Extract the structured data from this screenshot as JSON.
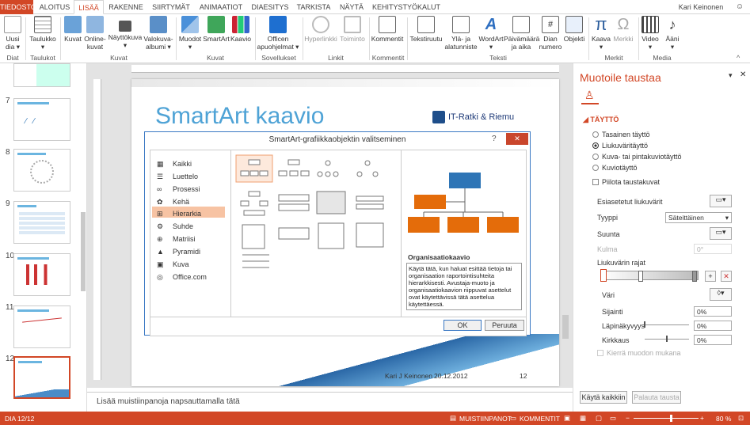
{
  "tabs": [
    "TIEDOSTO",
    "ALOITUS",
    "LISÄÄ",
    "RAKENNE",
    "SIIRTYMÄT",
    "ANIMAATIOT",
    "DIAESITYS",
    "TARKISTA",
    "NÄYTÄ",
    "KEHITYSTYÖKALUT"
  ],
  "user": "Kari Keinonen",
  "ribbon": {
    "buttons": [
      {
        "l1": "Uusi",
        "l2": "dia ▾"
      },
      {
        "l1": "Taulukko",
        "l2": "▾"
      },
      {
        "l1": "Kuvat",
        "l2": ""
      },
      {
        "l1": "Online-",
        "l2": "kuvat"
      },
      {
        "l1": "Näyttökuva",
        "l2": "▾"
      },
      {
        "l1": "Valokuva-",
        "l2": "albumi ▾"
      },
      {
        "l1": "Muodot",
        "l2": "▾"
      },
      {
        "l1": "SmartArt",
        "l2": ""
      },
      {
        "l1": "Kaavio",
        "l2": ""
      },
      {
        "l1": "Officen",
        "l2": "apuohjelmat ▾"
      },
      {
        "l1": "Hyperlinkki",
        "l2": ""
      },
      {
        "l1": "Toiminto",
        "l2": ""
      },
      {
        "l1": "Kommentit",
        "l2": ""
      },
      {
        "l1": "Tekstiruutu",
        "l2": ""
      },
      {
        "l1": "Ylä- ja",
        "l2": "alatunniste"
      },
      {
        "l1": "WordArt",
        "l2": "▾"
      },
      {
        "l1": "Päivämäärä",
        "l2": "ja aika"
      },
      {
        "l1": "Dian",
        "l2": "numero"
      },
      {
        "l1": "Objekti",
        "l2": ""
      },
      {
        "l1": "Kaava",
        "l2": "▾"
      },
      {
        "l1": "Merkki",
        "l2": ""
      },
      {
        "l1": "Video",
        "l2": "▾"
      },
      {
        "l1": "Ääni",
        "l2": "▾"
      }
    ],
    "groups": [
      "Diat",
      "Taulukot",
      "Kuvat",
      "Kuvat",
      "Sovellukset",
      "Linkit",
      "Kommentit",
      "Teksti",
      "Merkit",
      "Media"
    ]
  },
  "thumbs": [
    "7",
    "8",
    "9",
    "10",
    "11",
    "12"
  ],
  "slide": {
    "title": "SmartArt kaavio",
    "brand": "IT-Ratki & Riemu",
    "author": "Kari J Keinonen",
    "date": "20.12.2012",
    "num": "12"
  },
  "dialog": {
    "title": "SmartArt-grafiikkaobjektin valitseminen",
    "help": "?",
    "close": "✕",
    "categories": [
      "Kaikki",
      "Luettelo",
      "Prosessi",
      "Kehä",
      "Hierarkia",
      "Suhde",
      "Matriisi",
      "Pyramidi",
      "Kuva",
      "Office.com"
    ],
    "selected_category": "Hierarkia",
    "preview_title": "Organisaatiokaavio",
    "preview_desc": "Käytä tätä, kun haluat esittää tietoja tai organisaation raportointisuhteita hierarkkisesti. Avustaja-muoto ja organisaatiokaavion riippuvat asettelut ovat käytettävissä tätä asettelua käytettäessä.",
    "ok": "OK",
    "cancel": "Peruuta"
  },
  "notes": "Lisää muistiinpanoja napsauttamalla tätä",
  "pane": {
    "title": "Muotoile taustaa",
    "section": "TÄYTTÖ",
    "fill_options": [
      "Tasainen täyttö",
      "Liukuväritäyttö",
      "Kuva- tai pintakuviotäyttö",
      "Kuviotäyttö"
    ],
    "selected_fill": "Liukuväritäyttö",
    "hide_bg": "Piilota taustakuvat",
    "preset": "Esiasetetut liukuvärit",
    "type_label": "Tyyppi",
    "type_value": "Säteittäinen",
    "direction": "Suunta",
    "angle": "Kulma",
    "angle_value": "0°",
    "stops": "Liukuvärin rajat",
    "color": "Väri",
    "position": "Sijainti",
    "position_value": "0%",
    "transparency": "Läpinäkyvyys",
    "transparency_value": "0%",
    "brightness": "Kirkkaus",
    "brightness_value": "0%",
    "rotate": "Kierrä muodon mukana",
    "apply_all": "Käytä kaikkiin",
    "reset": "Palauta tausta"
  },
  "status": {
    "slide": "DIA 12/12",
    "notes": "MUISTIINPANOT",
    "comments": "KOMMENTIT",
    "zoom": "80 %"
  },
  "colors": {
    "accent": "#d24726",
    "title_blue": "#4fa3d6",
    "node_blue": "#2e75b6",
    "node_orange": "#e46c0a"
  }
}
